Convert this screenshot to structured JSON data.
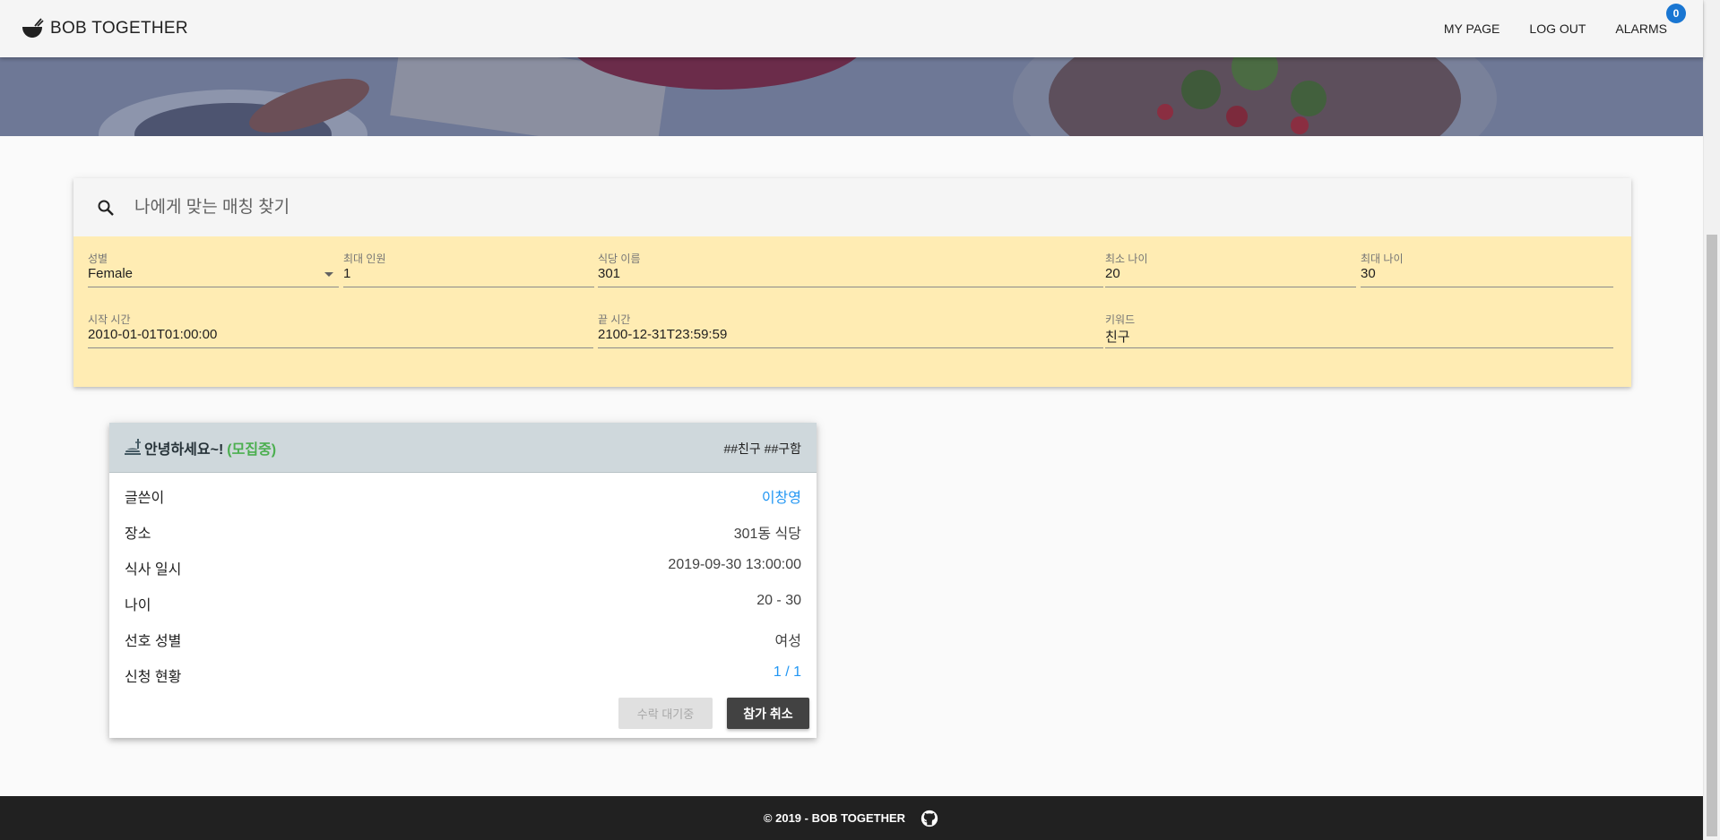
{
  "app": {
    "brand": "BOB TOGETHER",
    "nav": {
      "my_page": "MY PAGE",
      "log_out": "LOG OUT",
      "alarms": "ALARMS",
      "alarm_count": "0"
    }
  },
  "search": {
    "placeholder": "나에게 맞는 매칭 찾기",
    "filters": {
      "gender": {
        "label": "성별",
        "value": "Female"
      },
      "max_people": {
        "label": "최대 인원",
        "value": "1"
      },
      "restaurant": {
        "label": "식당 이름",
        "value": "301"
      },
      "min_age": {
        "label": "최소 나이",
        "value": "20"
      },
      "max_age": {
        "label": "최대 나이",
        "value": "30"
      },
      "start_time": {
        "label": "시작 시간",
        "value": "2010-01-01T01:00:00"
      },
      "end_time": {
        "label": "끝 시간",
        "value": "2100-12-31T23:59:59"
      },
      "keyword": {
        "label": "키워드",
        "value": "친구"
      }
    }
  },
  "card": {
    "title": "안녕하세요~!",
    "status": "(모집중)",
    "tags": "##친구 ##구함",
    "rows": [
      {
        "label": "글쓴이",
        "value": "이창영"
      },
      {
        "label": "장소",
        "value": "301동 식당"
      },
      {
        "label": "식사 일시",
        "value": "2019-09-30 13:00:00"
      },
      {
        "label": "나이",
        "value": "20 - 30"
      },
      {
        "label": "선호 성별",
        "value": "여성"
      },
      {
        "label": "신청 현황",
        "value": "1 / 1"
      }
    ],
    "buttons": {
      "waiting": "수락 대기중",
      "cancel": "참가 취소"
    }
  },
  "footer": {
    "text": "© 2019 - BOB TOGETHER"
  },
  "colors": {
    "filter_bg": "#ffecb3",
    "card_header": "#cfd8dc",
    "status_green": "#4caf50",
    "link_blue": "#2196f3",
    "badge_blue": "#1976d2",
    "footer_bg": "#212121"
  },
  "icons": {
    "brand": "rice-bowl-icon",
    "search": "search-icon",
    "card": "restaurant-icon",
    "footer": "github-icon"
  }
}
